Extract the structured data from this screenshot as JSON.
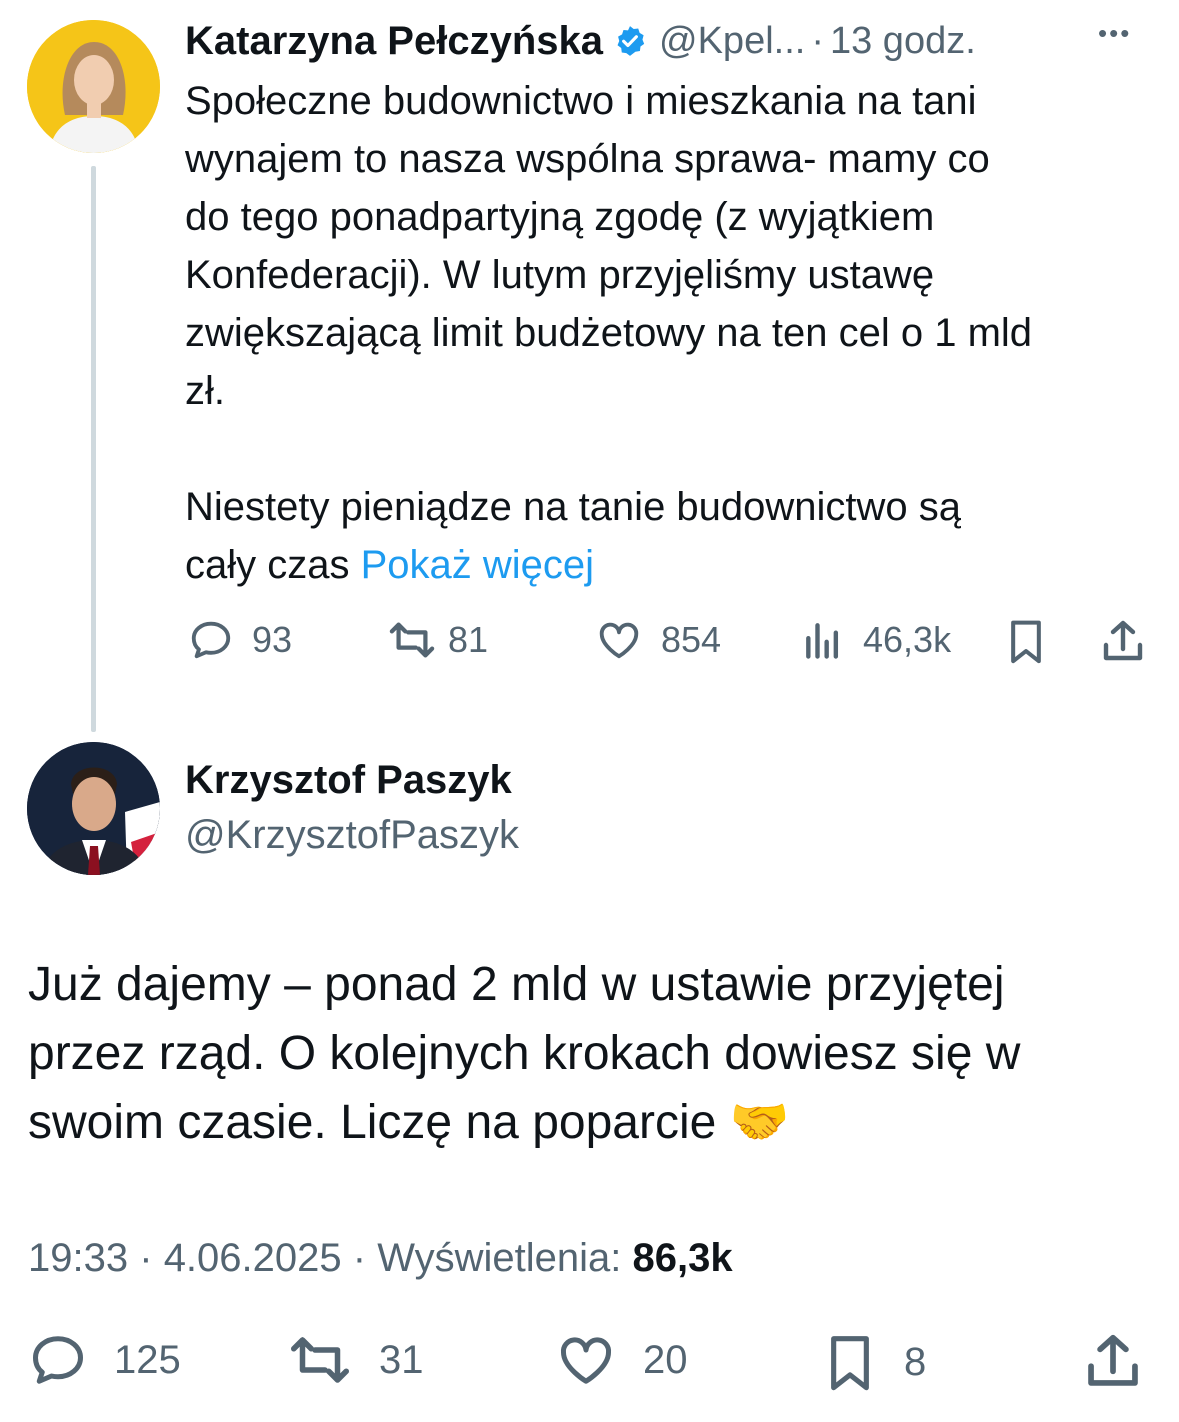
{
  "tweet1": {
    "author_name": "Katarzyna Pełczyńska",
    "handle": "@Kpel...",
    "separator": "·",
    "time": "13 godz.",
    "more_menu": "•••",
    "text": "Społeczne budownictwo i mieszkania na tani\nwynajem to nasza wspólna sprawa- mamy co\ndo tego ponadpartyjną zgodę (z wyjątkiem\nKonfederacji). W lutym przyjęliśmy ustawę\nzwiększającą limit budżetowy na ten cel o 1 mld\nzł.\n\nNiestety pieniądze na tanie budownictwo są\ncały czas ",
    "show_more": "Pokaż więcej",
    "replies": "93",
    "reposts": "81",
    "likes": "854",
    "views": "46,3k"
  },
  "tweet2": {
    "author_name": "Krzysztof Paszyk",
    "handle": "@KrzysztofPaszyk",
    "text": "Już dajemy – ponad 2 mld w ustawie przyjętej\nprzez rząd. O kolejnych krokach dowiesz się w\nswoim czasie. Liczę na poparcie 🤝",
    "time": "19:33",
    "dot1": "·",
    "date": "4.06.2025",
    "dot2": "·",
    "views_label": "Wyświetlenia:",
    "views": "86,3k",
    "replies": "125",
    "reposts": "31",
    "likes": "20",
    "bookmarks": "8"
  },
  "icons": {
    "verified": "verified-badge-icon",
    "reply": "reply-bubble-icon",
    "repost": "repost-arrows-icon",
    "like": "heart-icon",
    "views": "bar-chart-icon",
    "bookmark": "bookmark-icon",
    "share": "share-upload-icon"
  },
  "colors": {
    "link": "#1d9bf0",
    "muted": "#536471",
    "text": "#0f1419",
    "thread_line": "#cfd9de",
    "avatar1_bg": "#f5c518"
  }
}
